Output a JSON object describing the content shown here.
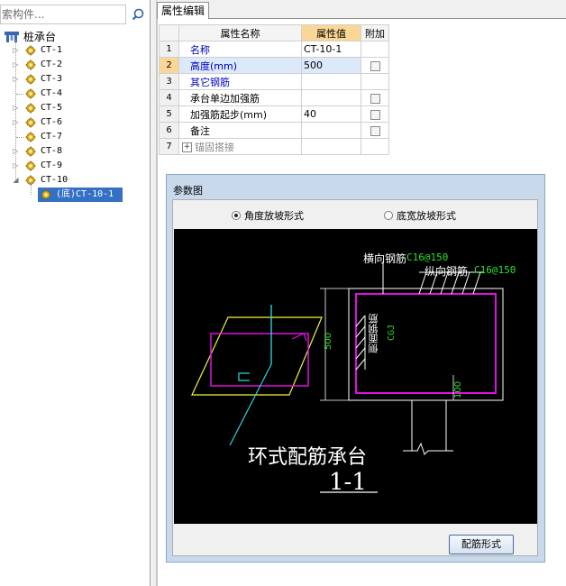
{
  "search": {
    "placeholder": "索构件..."
  },
  "tree": {
    "root": "桩承台",
    "items": [
      "CT-1",
      "CT-2",
      "CT-3",
      "CT-4",
      "CT-5",
      "CT-6",
      "CT-7",
      "CT-8",
      "CT-9",
      "CT-10"
    ],
    "child": "(底)CT-10-1"
  },
  "tab": {
    "label": "属性编辑"
  },
  "grid": {
    "headers": {
      "name": "属性名称",
      "value": "属性值",
      "extra": "附加"
    },
    "rows": [
      {
        "num": "1",
        "name": "名称",
        "value": "CT-10-1"
      },
      {
        "num": "2",
        "name": "高度(mm)",
        "value": "500"
      },
      {
        "num": "3",
        "name": "其它钢筋",
        "value": ""
      },
      {
        "num": "4",
        "name": "承台单边加强筋",
        "value": ""
      },
      {
        "num": "5",
        "name": "加强筋起步(mm)",
        "value": "40"
      },
      {
        "num": "6",
        "name": "备注",
        "value": ""
      },
      {
        "num": "7",
        "name": "锚固搭接",
        "value": ""
      }
    ]
  },
  "dialog": {
    "title": "参数图",
    "radio1": "角度放坡形式",
    "radio2": "底宽放坡形式",
    "button": "配筋形式"
  },
  "drawing": {
    "label_hrebar": "横向钢筋",
    "spec_h": "C16@150",
    "label_vrebar": "纵向钢筋",
    "spec_v": "C16@150",
    "label_side": "侧面钢筋",
    "side_spec": "CGJ",
    "dim_500": "500",
    "dim_100": "100",
    "title": "环式配筋承台",
    "section": "1-1"
  },
  "colors": {
    "accent": "#fad796",
    "selected": "#3470c4",
    "blue_text": "#0000c0",
    "canvas": "#000000"
  }
}
